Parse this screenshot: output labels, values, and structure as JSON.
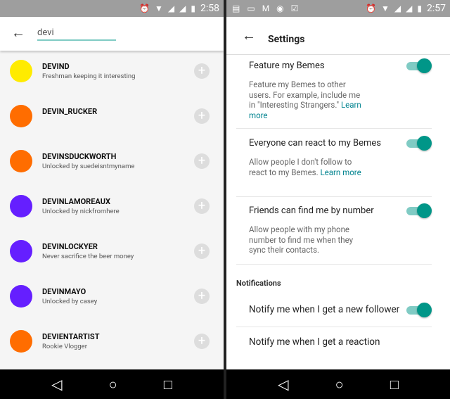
{
  "left": {
    "status": {
      "time": "2:58"
    },
    "search": {
      "value": "devi"
    },
    "users": [
      {
        "name": "DEVIND",
        "subtitle": "Freshman keeping it interesting",
        "color": "#ffeb00"
      },
      {
        "name": "DEVIN_RUCKER",
        "subtitle": "",
        "color": "#ff6d00"
      },
      {
        "name": "DEVINSDUCKWORTH",
        "subtitle": "Unlocked by suedeisntmyname",
        "color": "#ff6d00"
      },
      {
        "name": "DEVINLAMOREAUX",
        "subtitle": "Unlocked by nickfromhere",
        "color": "#651fff"
      },
      {
        "name": "DEVINLOCKYER",
        "subtitle": "Never sacrifice the beer money",
        "color": "#651fff"
      },
      {
        "name": "DEVINMAYO",
        "subtitle": "Unlocked by casey",
        "color": "#651fff"
      },
      {
        "name": "DEVIENTARTIST",
        "subtitle": "Rookie Vlogger",
        "color": "#ff6d00"
      }
    ]
  },
  "right": {
    "status": {
      "time": "2:57"
    },
    "title": "Settings",
    "settings": [
      {
        "title": "Feature my Bemes",
        "desc": "Feature my Bemes to other users. For example, include me in \"Interesting Strangers.\" ",
        "link": "Learn more",
        "on": true
      },
      {
        "title": "Everyone can react to my Bemes",
        "desc": "Allow people I don't follow to react to my Bemes. ",
        "link": "Learn more",
        "on": true
      },
      {
        "title": "Friends can find me by number",
        "desc": "Allow people with my phone number to find me when they sync their contacts.",
        "link": "",
        "on": true
      }
    ],
    "section": "Notifications",
    "notifications": [
      {
        "title": "Notify me when I get a new follower",
        "on": true
      },
      {
        "title": "Notify me when I get a reaction"
      }
    ]
  },
  "accent": "#009688"
}
